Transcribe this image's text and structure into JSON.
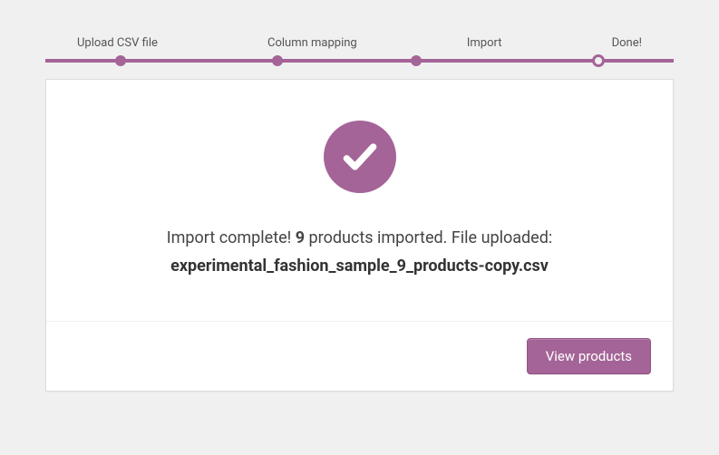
{
  "steps": {
    "step1": "Upload CSV file",
    "step2": "Column mapping",
    "step3": "Import",
    "step4": "Done!"
  },
  "message": {
    "prefix": "Import complete! ",
    "count": "9",
    "suffix": " products imported. File uploaded:",
    "filename": "experimental_fashion_sample_9_products-copy.csv"
  },
  "actions": {
    "view_products": "View products"
  }
}
